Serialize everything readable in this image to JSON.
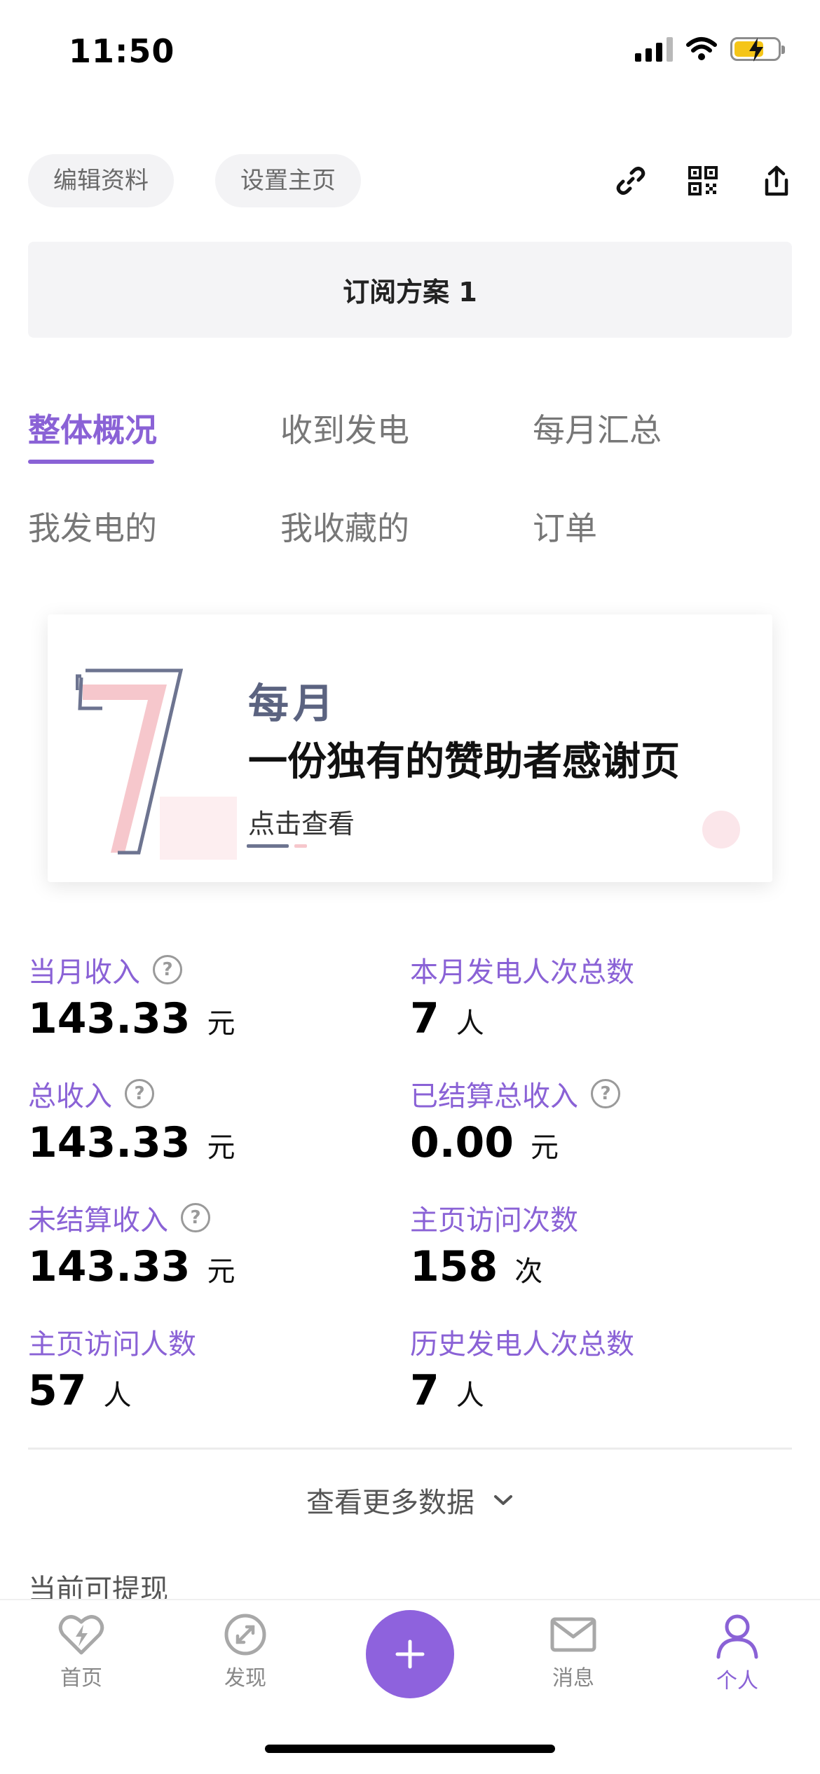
{
  "status_bar": {
    "time": "11:50"
  },
  "actions": {
    "edit_profile": "编辑资料",
    "set_homepage": "设置主页"
  },
  "plan": {
    "title": "订阅方案 1"
  },
  "tabs": {
    "row1": [
      "整体概况",
      "收到发电",
      "每月汇总"
    ],
    "row2": [
      "我发电的",
      "我收藏的",
      "订单"
    ],
    "active": "整体概况"
  },
  "banner": {
    "month": "每月",
    "title": "一份独有的赞助者感谢页",
    "link": "点击查看"
  },
  "stats": [
    {
      "label": "当月收入",
      "value": "143.33",
      "unit": "元",
      "help": true
    },
    {
      "label": "本月发电人次总数",
      "value": "7",
      "unit": "人",
      "help": false
    },
    {
      "label": "总收入",
      "value": "143.33",
      "unit": "元",
      "help": true
    },
    {
      "label": "已结算总收入",
      "value": "0.00",
      "unit": "元",
      "help": true
    },
    {
      "label": "未结算收入",
      "value": "143.33",
      "unit": "元",
      "help": true
    },
    {
      "label": "主页访问次数",
      "value": "158",
      "unit": "次",
      "help": false
    },
    {
      "label": "主页访问人数",
      "value": "57",
      "unit": "人",
      "help": false
    },
    {
      "label": "历史发电人次总数",
      "value": "7",
      "unit": "人",
      "help": false
    }
  ],
  "help_symbol": "?",
  "more_data": "查看更多数据",
  "withdraw_label": "当前可提现",
  "tabbar": {
    "home": "首页",
    "discover": "发现",
    "messages": "消息",
    "profile": "个人"
  },
  "colors": {
    "accent": "#8a62d6",
    "battery": "#f5c518"
  }
}
